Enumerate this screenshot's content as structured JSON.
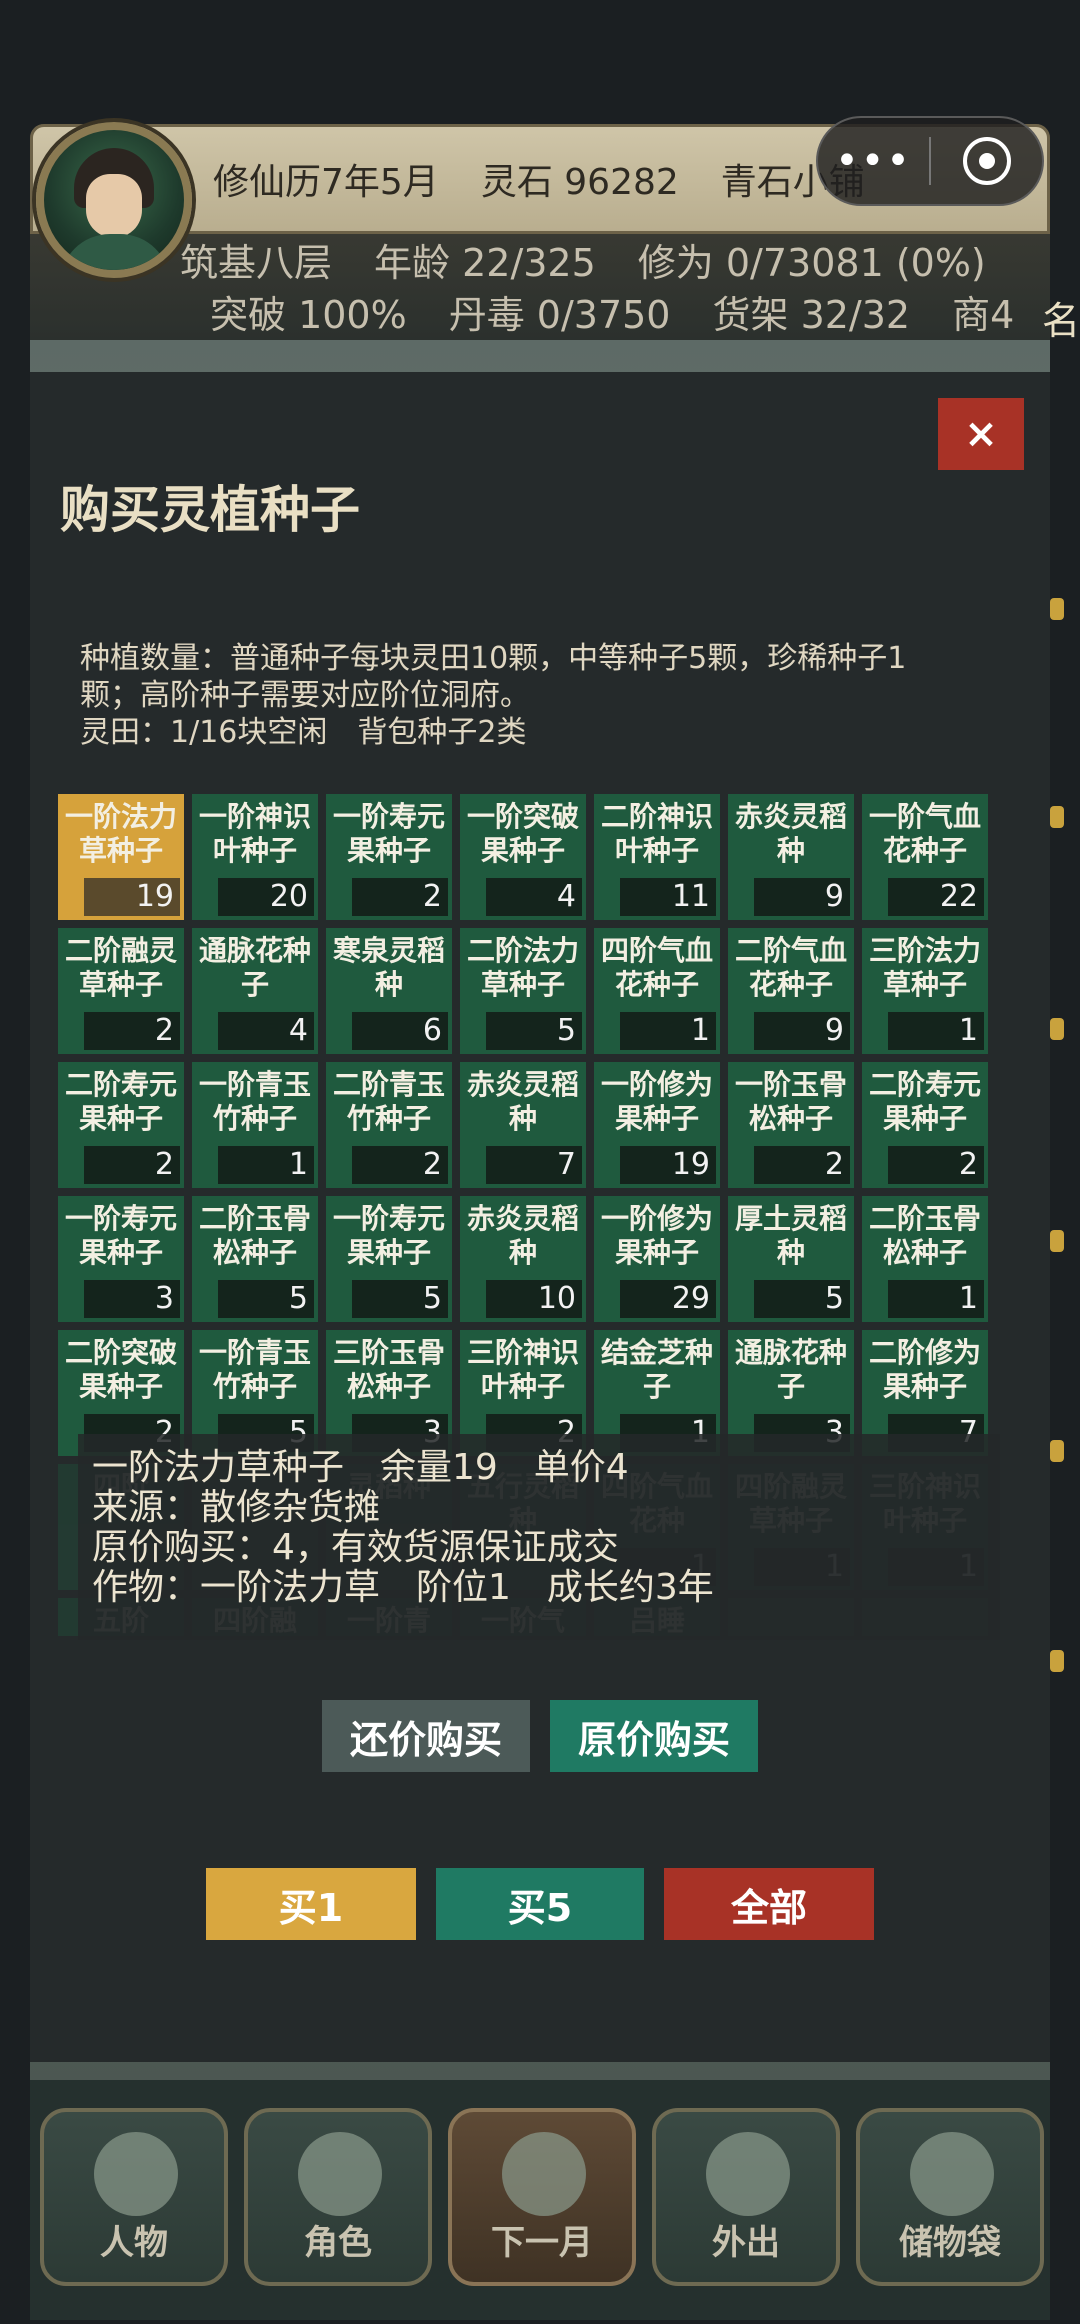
{
  "hud": {
    "calendar": "修仙历7年5月",
    "spirit_stones": "灵石 96282",
    "shop": "青石小铺",
    "realm": "筑基八层",
    "age": "年龄 22/325",
    "cultivation": "修为 0/73081 (0%)",
    "breakthrough": "突破 100%",
    "pill_poison": "丹毒 0/3750",
    "shelf": "货架 32/32",
    "merchant": "商4",
    "cut_label": "名"
  },
  "capsule": {
    "more_icon": "more-dots-icon",
    "target_icon": "target-icon"
  },
  "modal": {
    "close": "×",
    "title": "购买灵植种子",
    "desc_line1": "种植数量：普通种子每块灵田10颗，中等种子5颗，珍稀种子1",
    "desc_line2": "颗；高阶种子需要对应阶位洞府。",
    "desc_line3": "灵田：1/16块空闲　背包种子2类"
  },
  "seeds": [
    {
      "name": "一阶法力草种子",
      "qty": "19"
    },
    {
      "name": "一阶神识叶种子",
      "qty": "20"
    },
    {
      "name": "一阶寿元果种子",
      "qty": "2"
    },
    {
      "name": "一阶突破果种子",
      "qty": "4"
    },
    {
      "name": "二阶神识叶种子",
      "qty": "11"
    },
    {
      "name": "赤炎灵稻种",
      "qty": "9"
    },
    {
      "name": "一阶气血花种子",
      "qty": "22"
    },
    {
      "name": "二阶融灵草种子",
      "qty": "2"
    },
    {
      "name": "通脉花种子",
      "qty": "4"
    },
    {
      "name": "寒泉灵稻种",
      "qty": "6"
    },
    {
      "name": "二阶法力草种子",
      "qty": "5"
    },
    {
      "name": "四阶气血花种子",
      "qty": "1"
    },
    {
      "name": "二阶气血花种子",
      "qty": "9"
    },
    {
      "name": "三阶法力草种子",
      "qty": "1"
    },
    {
      "name": "二阶寿元果种子",
      "qty": "2"
    },
    {
      "name": "一阶青玉竹种子",
      "qty": "1"
    },
    {
      "name": "二阶青玉竹种子",
      "qty": "2"
    },
    {
      "name": "赤炎灵稻种",
      "qty": "7"
    },
    {
      "name": "一阶修为果种子",
      "qty": "19"
    },
    {
      "name": "一阶玉骨松种子",
      "qty": "2"
    },
    {
      "name": "二阶寿元果种子",
      "qty": "2"
    },
    {
      "name": "一阶寿元果种子",
      "qty": "3"
    },
    {
      "name": "二阶玉骨松种子",
      "qty": "5"
    },
    {
      "name": "一阶寿元果种子",
      "qty": "5"
    },
    {
      "name": "赤炎灵稻种",
      "qty": "10"
    },
    {
      "name": "一阶修为果种子",
      "qty": "29"
    },
    {
      "name": "厚土灵稻种",
      "qty": "5"
    },
    {
      "name": "二阶玉骨松种子",
      "qty": "1"
    },
    {
      "name": "二阶突破果种子",
      "qty": "2"
    },
    {
      "name": "一阶青玉竹种子",
      "qty": "5"
    },
    {
      "name": "三阶玉骨松种子",
      "qty": "3"
    },
    {
      "name": "三阶神识叶种子",
      "qty": "2"
    },
    {
      "name": "结金芝种子",
      "qty": "1"
    },
    {
      "name": "通脉花种子",
      "qty": "3"
    },
    {
      "name": "二阶修为果种子",
      "qty": "7"
    },
    {
      "name": "四阶",
      "qty": ""
    },
    {
      "name": "",
      "qty": ""
    },
    {
      "name": "灵稻种",
      "qty": ""
    },
    {
      "name": "五行灵稻种",
      "qty": ""
    },
    {
      "name": "四阶气血花种",
      "qty": "1"
    },
    {
      "name": "四阶融灵草种子",
      "qty": "1"
    },
    {
      "name": "三阶神识叶种子",
      "qty": "1"
    },
    {
      "name": "五阶",
      "qty": ""
    },
    {
      "name": "四阶融",
      "qty": ""
    },
    {
      "name": "一阶青",
      "qty": ""
    },
    {
      "name": "一阶气",
      "qty": ""
    },
    {
      "name": "吕睡",
      "qty": ""
    },
    {
      "name": "",
      "qty": ""
    },
    {
      "name": "",
      "qty": ""
    }
  ],
  "info": {
    "line1": "一阶法力草种子　余量19　单价4",
    "line2": "来源：散修杂货摊",
    "line3": "原价购买：4，有效货源保证成交",
    "line4": "作物：一阶法力草　阶位1　成长约3年"
  },
  "buttons": {
    "bargain": "还价购买",
    "full_price": "原价购买",
    "buy1": "买1",
    "buy5": "买5",
    "all": "全部"
  },
  "nav": [
    {
      "label": "人物",
      "icon": "person-icon"
    },
    {
      "label": "角色",
      "icon": "bag-icon"
    },
    {
      "label": "下一月",
      "icon": "flag-icon"
    },
    {
      "label": "外出",
      "icon": "flower-icon"
    },
    {
      "label": "储物袋",
      "icon": "storage-bag-icon"
    }
  ]
}
